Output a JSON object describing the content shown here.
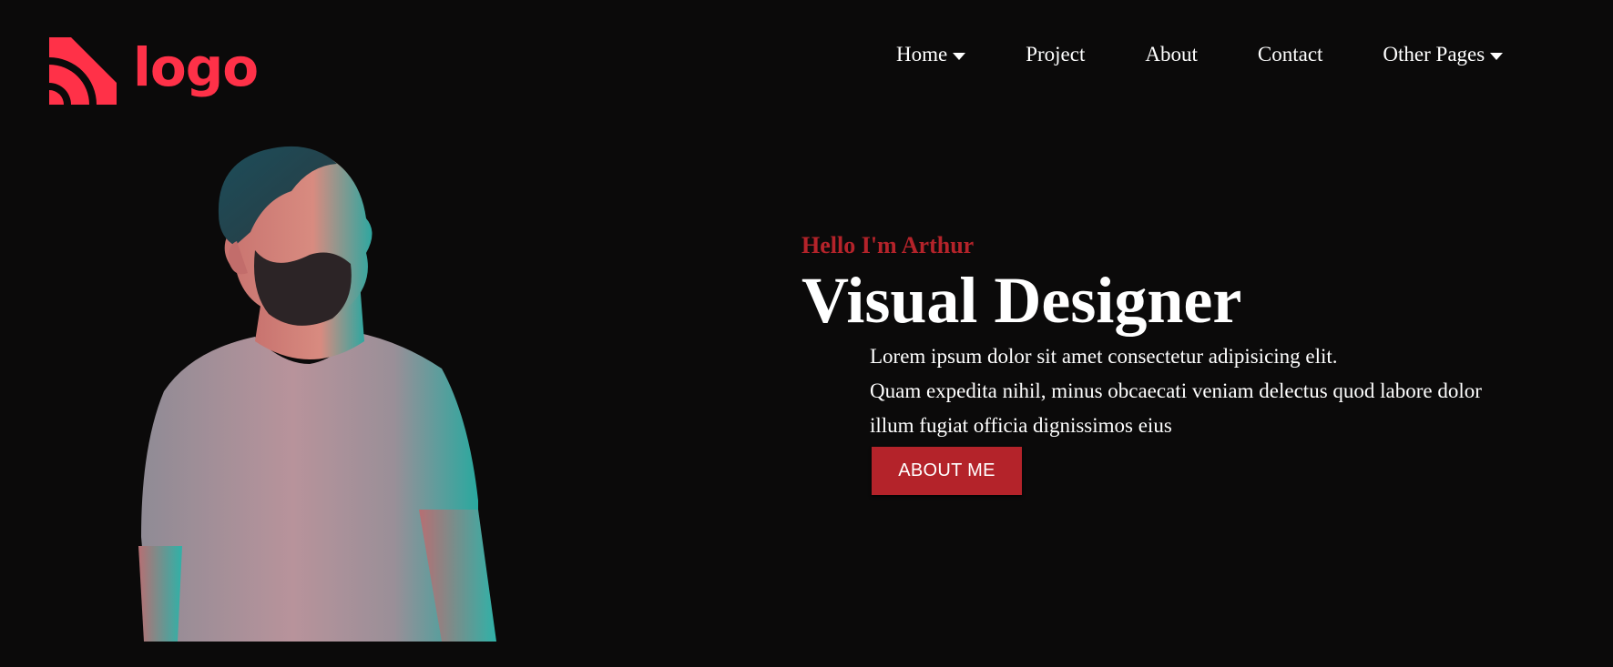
{
  "colors": {
    "background": "#0b0a0a",
    "brand": "#ff3148",
    "accent": "#b4232a",
    "text": "#ffffff"
  },
  "header": {
    "logo_icon": "wifi-arcs-logo-icon",
    "logo_text": "logo",
    "nav": [
      {
        "label": "Home",
        "has_dropdown": true,
        "caret_icon": "caret-down-icon"
      },
      {
        "label": "Project",
        "has_dropdown": false
      },
      {
        "label": "About",
        "has_dropdown": false
      },
      {
        "label": "Contact",
        "has_dropdown": false
      },
      {
        "label": "Other Pages",
        "has_dropdown": true,
        "caret_icon": "caret-down-icon"
      }
    ]
  },
  "hero": {
    "greeting": "Hello I'm Arthur",
    "title": "Visual Designer",
    "description_lines": [
      "Lorem ipsum dolor sit amet consectetur adipisicing elit.",
      "Quam expedita nihil, minus obcaecati veniam delectus quod labore dolor",
      "illum fugiat officia dignissimos eius"
    ],
    "button_label": "ABOUT ME",
    "portrait_icon": "person-portrait"
  }
}
